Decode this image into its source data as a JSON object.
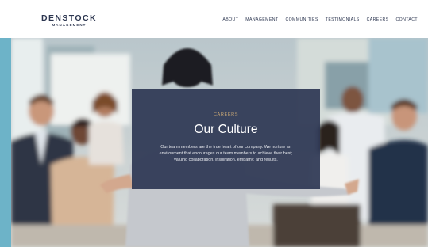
{
  "brand": {
    "name": "DENSTOCK",
    "subtitle": "MANAGEMENT"
  },
  "nav": {
    "items": [
      "ABOUT",
      "MANAGEMENT",
      "COMMUNITIES",
      "TESTIMONIALS",
      "CAREERS",
      "CONTACT"
    ]
  },
  "hero": {
    "eyebrow": "CAREERS",
    "title": "Our Culture",
    "body": "Our team members are the true heart of our company. We nurture an environment that encourages our team members to achieve their best; valuing collaboration, inspiration, empathy, and results."
  },
  "colors": {
    "accent_bar": "#6db3c8",
    "panel": "#2e3854",
    "eyebrow": "#c9a876",
    "brand": "#2c3650"
  }
}
